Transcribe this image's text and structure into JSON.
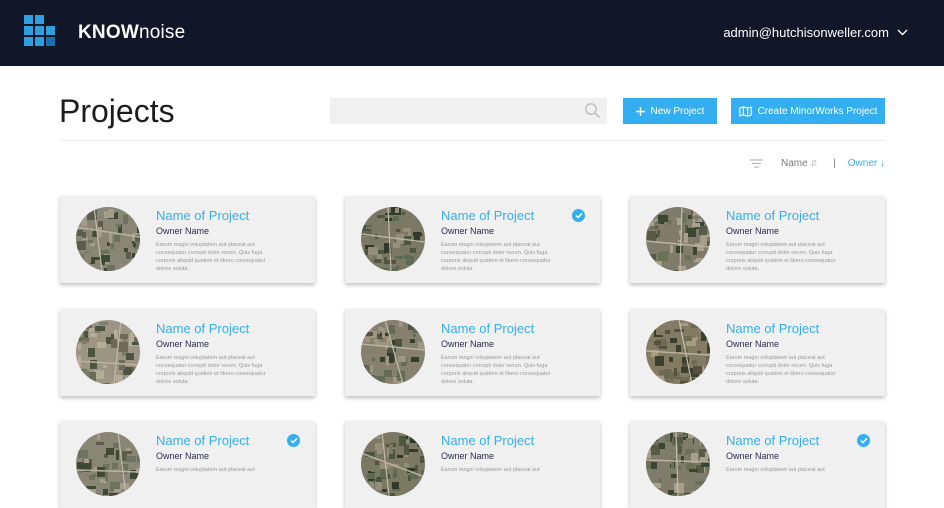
{
  "header": {
    "brand_bold": "KNOW",
    "brand_light": "noise",
    "user_email": "admin@hutchisonweller.com",
    "logo_icon": "grid-logo-icon",
    "dropdown_icon": "chevron-down-icon"
  },
  "page": {
    "title": "Projects",
    "search_placeholder": "",
    "new_project_label": "New Project",
    "minorworks_label": "Create MinorWorks Project"
  },
  "sort": {
    "name_label": "Name",
    "name_arrow": "⇵",
    "separator": "|",
    "owner_label": "Owner",
    "owner_arrow": "↓"
  },
  "colors": {
    "topbar": "#121629",
    "accent": "#33aef0",
    "card_bg": "#f0f0f0"
  },
  "projects": [
    {
      "name": "Name of Project",
      "owner": "Owner Name",
      "description": "Earum magni voluptatem aut placeat aut consequatur corrupti dolor rerum. Quis fuga corporis aliquid quidem et libero consequatur dolore soluta.",
      "selected": false
    },
    {
      "name": "Name of Project",
      "owner": "Owner Name",
      "description": "Earum magni voluptatem aut placeat aut consequatur corrupti dolor rerum. Quis fuga corporis aliquid quidem et libero consequatur dolore soluta.",
      "selected": true
    },
    {
      "name": "Name of Project",
      "owner": "Owner Name",
      "description": "Earum magni voluptatem aut placeat aut consequatur corrupti dolor rerum. Quis fuga corporis aliquid quidem et libero consequatur dolore soluta.",
      "selected": false
    },
    {
      "name": "Name of Project",
      "owner": "Owner Name",
      "description": "Earum magni voluptatem aut placeat aut consequatur corrupti dolor rerum. Quis fuga corporis aliquid quidem et libero consequatur dolore soluta.",
      "selected": false
    },
    {
      "name": "Name of Project",
      "owner": "Owner Name",
      "description": "Earum magni voluptatem aut placeat aut consequatur corrupti dolor rerum. Quis fuga corporis aliquid quidem et libero consequatur dolore soluta.",
      "selected": false
    },
    {
      "name": "Name of Project",
      "owner": "Owner Name",
      "description": "Earum magni voluptatem aut placeat aut consequatur corrupti dolor rerum. Quis fuga corporis aliquid quidem et libero consequatur dolore soluta.",
      "selected": false
    },
    {
      "name": "Name of Project",
      "owner": "Owner Name",
      "description": "Earum magni voluptatem aut placeat aut",
      "selected": true
    },
    {
      "name": "Name of Project",
      "owner": "Owner Name",
      "description": "Earum magni voluptatem aut placeat aut",
      "selected": false
    },
    {
      "name": "Name of Project",
      "owner": "Owner Name",
      "description": "Earum magni voluptatem aut placeat aut",
      "selected": true
    }
  ]
}
